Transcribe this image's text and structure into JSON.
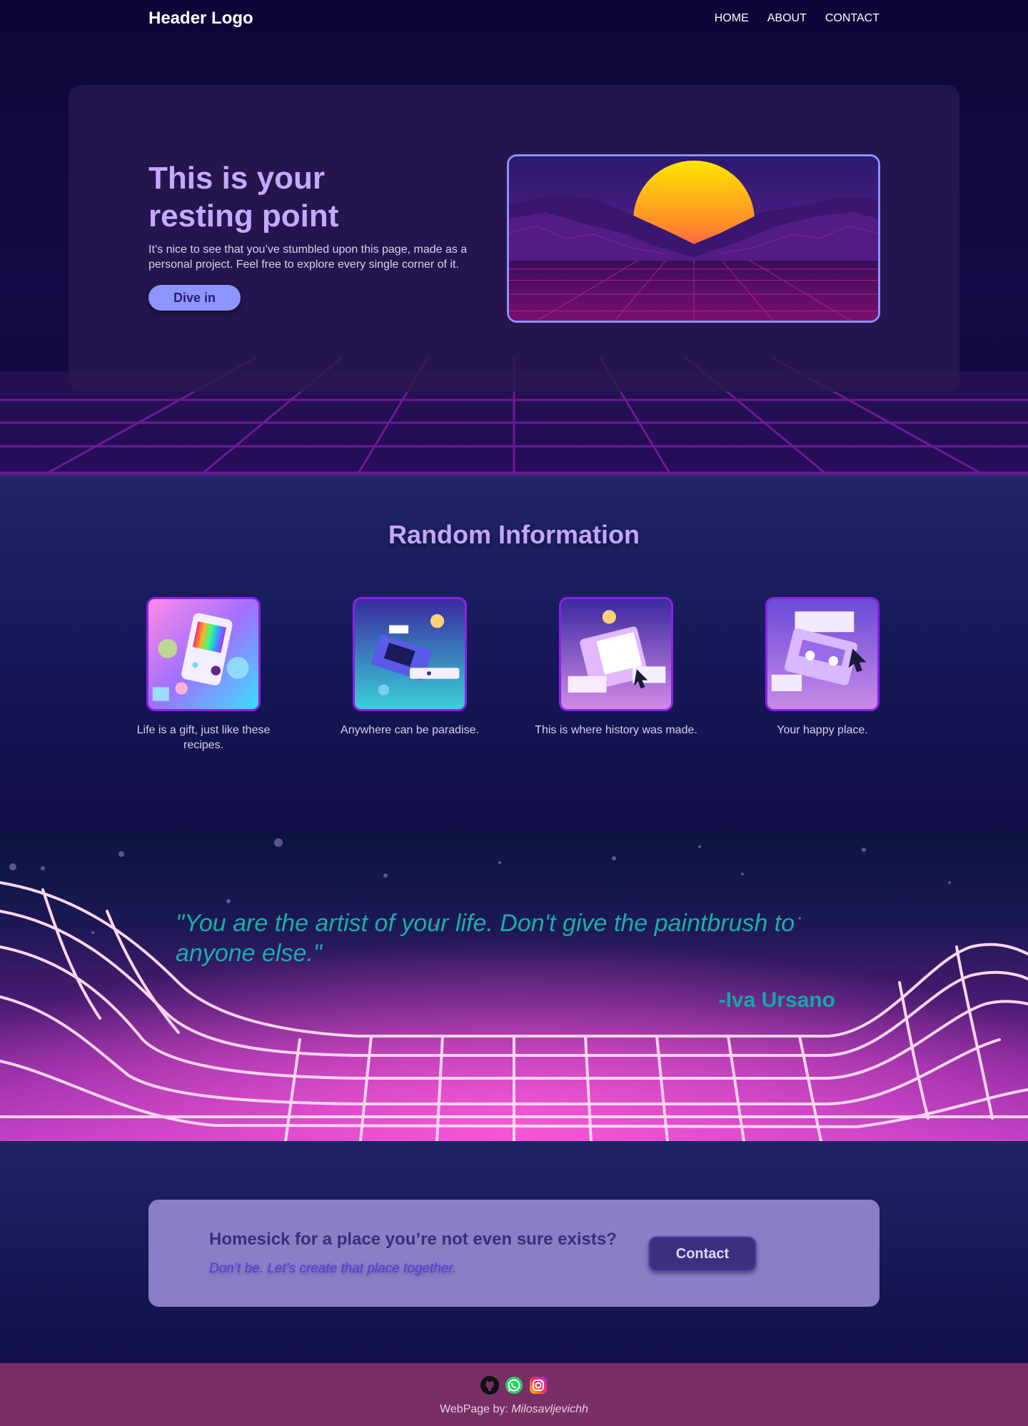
{
  "header": {
    "logo": "Header Logo",
    "nav": [
      {
        "label": "HOME"
      },
      {
        "label": "ABOUT"
      },
      {
        "label": "CONTACT"
      }
    ]
  },
  "hero": {
    "title": "This is your resting point",
    "description": "It’s nice to see that you’ve stumbled upon this page, made as a personal project. Feel free to explore every single corner of it.",
    "button": "Dive in"
  },
  "info": {
    "title": "Random Information",
    "cards": [
      {
        "caption": "Life is a gift, just like these recipes.",
        "image": "retro-handheld-console"
      },
      {
        "caption": "Anywhere can be paradise.",
        "image": "retro-vhs-player"
      },
      {
        "caption": "This is where history was made.",
        "image": "retro-floppy-disk"
      },
      {
        "caption": "Your happy place.",
        "image": "retro-cassette-tape"
      }
    ]
  },
  "quote": {
    "text": "\"You are the artist of your life. Don't give the paintbrush to anyone else.\"",
    "author": "-Iva Ursano"
  },
  "cta": {
    "heading": "Homesick for a place you’re not even sure exists?",
    "sub": "Don’t be. Let’s create that place together.",
    "button": "Contact"
  },
  "footer": {
    "credit_prefix": "WebPage by: ",
    "credit_name": "Milosavljevichh",
    "socials": [
      "github-icon",
      "whatsapp-icon",
      "instagram-icon"
    ]
  },
  "colors": {
    "accent": "#c6a8ff",
    "button": "#8e95ff",
    "quote": "#17b0a8",
    "footer": "#7a2e66"
  }
}
